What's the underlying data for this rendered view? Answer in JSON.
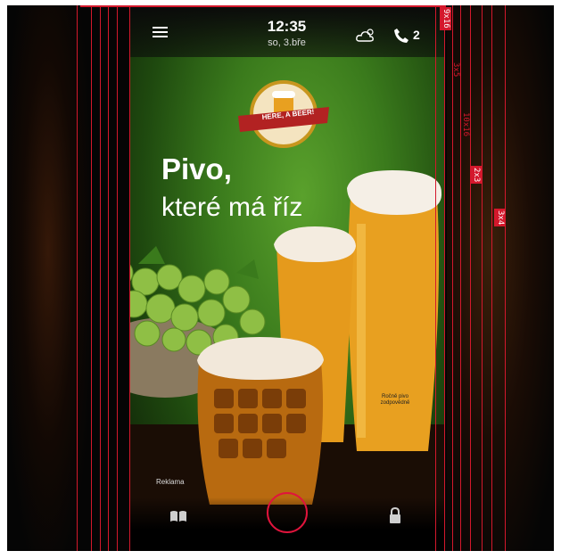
{
  "status_bar": {
    "time": "12:35",
    "date": "so, 3.bře",
    "missed_calls": "2",
    "icons": [
      "menu-icon",
      "weather-icon",
      "phone-icon"
    ]
  },
  "ad": {
    "logo_text": "HERE, A BEER!",
    "headline_bold": "Pivo,",
    "headline_light": "které má říz",
    "label": "Reklama",
    "glass_print": "Ročně pivo zodpovědně"
  },
  "bottom_bar": {
    "icons": [
      "book-icon",
      "home-button",
      "lock-icon"
    ]
  },
  "grid_tags": [
    "9x16",
    "3x5",
    "10x16",
    "2x3",
    "3x4"
  ],
  "colors": {
    "grid_line": "#d4182c",
    "background": "#050505",
    "green": "#3a7a1c",
    "beer": "#e8a020"
  }
}
